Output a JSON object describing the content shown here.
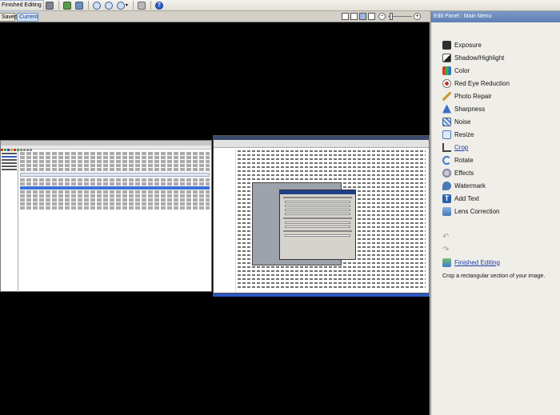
{
  "toolbar": {
    "finished_editing_label": "Finished Editing"
  },
  "tabs": {
    "saved_label": "Saved",
    "current_label": "Current"
  },
  "zoom": {
    "minus": "−",
    "plus": "+"
  },
  "panel": {
    "title": "Edit Panel : Main Menu",
    "items": [
      {
        "label": "Exposure",
        "icon": "exposure-icon",
        "color": "#2f2f2f"
      },
      {
        "label": "Shadow/Highlight",
        "icon": "shadow-highlight-icon",
        "color": "#3b3b3b"
      },
      {
        "label": "Color",
        "icon": "color-icon",
        "color": "#d83a2a"
      },
      {
        "label": "Red Eye Reduction",
        "icon": "red-eye-icon",
        "color": "#c0302a"
      },
      {
        "label": "Photo Repair",
        "icon": "photo-repair-icon",
        "color": "#c99a3a"
      },
      {
        "label": "Sharpness",
        "icon": "sharpness-icon",
        "color": "#3a6fc9"
      },
      {
        "label": "Noise",
        "icon": "noise-icon",
        "color": "#5a86c4"
      },
      {
        "label": "Resize",
        "icon": "resize-icon",
        "color": "#4a7ab8"
      },
      {
        "label": "Crop",
        "icon": "crop-icon",
        "color": "#444444"
      },
      {
        "label": "Rotate",
        "icon": "rotate-icon",
        "color": "#3a7ad0"
      },
      {
        "label": "Effects",
        "icon": "effects-icon",
        "color": "#6a6a9a"
      },
      {
        "label": "Watermark",
        "icon": "watermark-icon",
        "color": "#4a7ab8"
      },
      {
        "label": "Add Text",
        "icon": "add-text-icon",
        "color": "#2a5fae"
      },
      {
        "label": "Lens Correction",
        "icon": "lens-correction-icon",
        "color": "#3f77b9"
      }
    ],
    "finished_editing_label": "Finished Editing",
    "description": "Crop a rectangular section of your image."
  }
}
